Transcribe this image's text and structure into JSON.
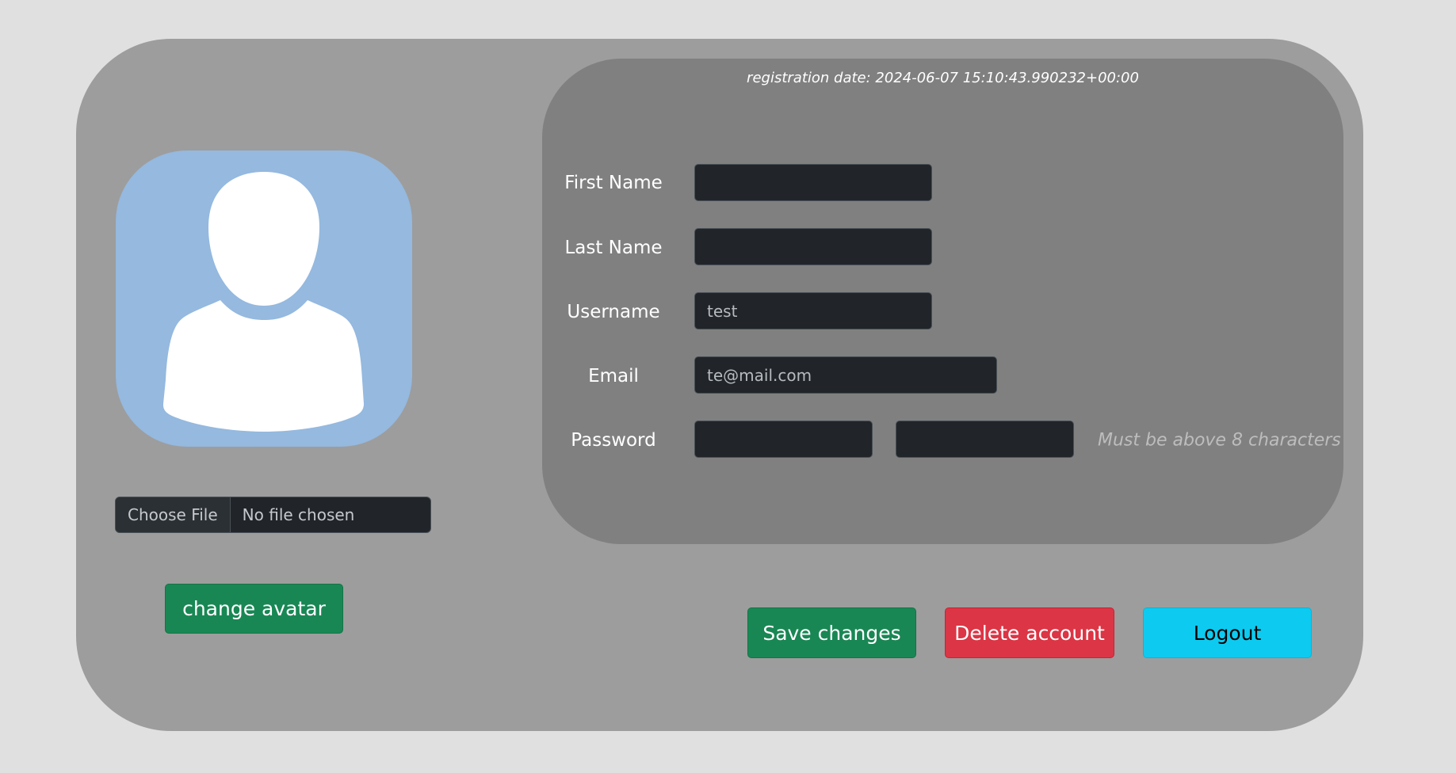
{
  "registration": {
    "label": "registration date: 2024-06-07 15:10:43.990232+00:00"
  },
  "avatar": {
    "icon": "user-silhouette-icon",
    "background_color": "#95b9df"
  },
  "file_input": {
    "button_label": "Choose File",
    "status_text": "No file chosen"
  },
  "change_avatar_label": "change avatar",
  "form": {
    "first_name": {
      "label": "First Name",
      "value": ""
    },
    "last_name": {
      "label": "Last Name",
      "value": ""
    },
    "username": {
      "label": "Username",
      "value": "test"
    },
    "email": {
      "label": "Email",
      "value": "te@mail.com"
    },
    "password": {
      "label": "Password",
      "value": "",
      "confirm_value": "",
      "hint": "Must be above 8 characters"
    }
  },
  "actions": {
    "save_label": "Save changes",
    "delete_label": "Delete account",
    "logout_label": "Logout"
  },
  "colors": {
    "save": "#198754",
    "delete": "#dc3545",
    "logout": "#0dcaf0"
  }
}
